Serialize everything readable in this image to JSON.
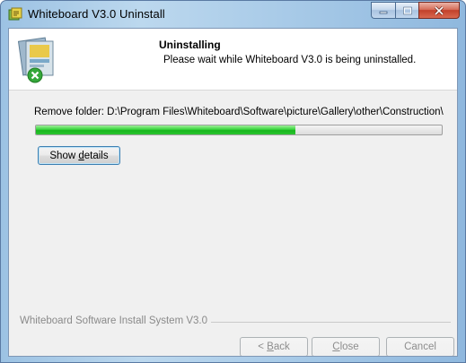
{
  "window": {
    "title": "Whiteboard V3.0 Uninstall"
  },
  "header": {
    "title": "Uninstalling",
    "subtitle": "Please wait while Whiteboard V3.0 is being uninstalled."
  },
  "status": {
    "text": "Remove folder: D:\\Program Files\\Whiteboard\\Software\\picture\\Gallery\\other\\Construction\\"
  },
  "progress": {
    "percent": 64
  },
  "buttons": {
    "show_details_pre": "Show ",
    "show_details_key": "d",
    "show_details_post": "etails",
    "back_pre": "< ",
    "back_key": "B",
    "back_post": "ack",
    "close_key": "C",
    "close_post": "lose",
    "cancel": "Cancel"
  },
  "footer": {
    "branding": "Whiteboard Software Install System V3.0"
  },
  "colors": {
    "progress_fill": "#2cc630",
    "close_button": "#c2402a"
  },
  "icons": {
    "app": "installer-icon",
    "header": "uninstall-package-icon"
  }
}
